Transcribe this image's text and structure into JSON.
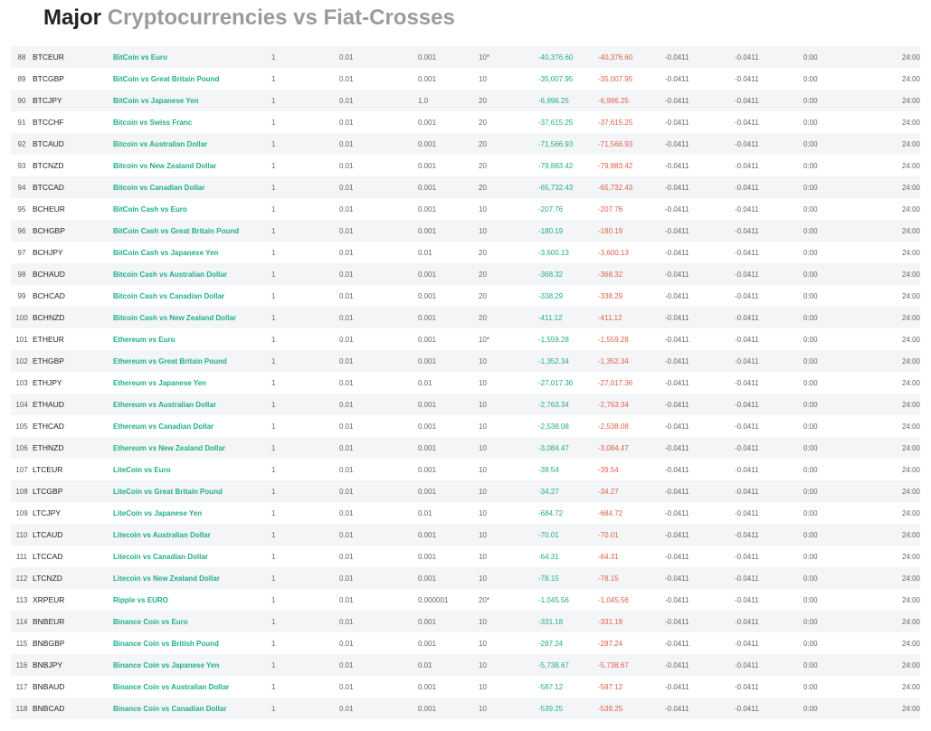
{
  "page": {
    "title_bold": "Major",
    "title_light": "Cryptocurrencies vs Fiat-Crosses"
  },
  "rows": [
    {
      "num": "88",
      "symbol": "BTCEUR",
      "desc": "BitCoin vs Euro",
      "contract": "1",
      "min": "0.01",
      "tick": "0.001",
      "leverage": "10*",
      "long": "-40,376.60",
      "short": "-40,376.60",
      "c1": "-0.0411",
      "c2": "-0.0411",
      "open": "0:00",
      "close": "24:00"
    },
    {
      "num": "89",
      "symbol": "BTCGBP",
      "desc": "BitCoin vs Great Britain Pound",
      "contract": "1",
      "min": "0.01",
      "tick": "0.001",
      "leverage": "10",
      "long": "-35,007.95",
      "short": "-35,007.95",
      "c1": "-0.0411",
      "c2": "-0.0411",
      "open": "0:00",
      "close": "24:00"
    },
    {
      "num": "90",
      "symbol": "BTCJPY",
      "desc": "BitCoin vs Japanese Yen",
      "contract": "1",
      "min": "0.01",
      "tick": "1.0",
      "leverage": "20",
      "long": "-6,996.25",
      "short": "-6,996.25",
      "c1": "-0.0411",
      "c2": "-0.0411",
      "open": "0:00",
      "close": "24:00"
    },
    {
      "num": "91",
      "symbol": "BTCCHF",
      "desc": "Bitcoin vs Swiss Franc",
      "contract": "1",
      "min": "0.01",
      "tick": "0.001",
      "leverage": "20",
      "long": "-37,615.25",
      "short": "-37,615.25",
      "c1": "-0.0411",
      "c2": "-0.0411",
      "open": "0:00",
      "close": "24:00"
    },
    {
      "num": "92",
      "symbol": "BTCAUD",
      "desc": "Bitcoin vs Australian Dollar",
      "contract": "1",
      "min": "0.01",
      "tick": "0.001",
      "leverage": "20",
      "long": "-71,566.93",
      "short": "-71,566.93",
      "c1": "-0.0411",
      "c2": "-0.0411",
      "open": "0:00",
      "close": "24:00"
    },
    {
      "num": "93",
      "symbol": "BTCNZD",
      "desc": "Bitcoin vs New Zealand Dollar",
      "contract": "1",
      "min": "0.01",
      "tick": "0.001",
      "leverage": "20",
      "long": "-79,883.42",
      "short": "-79,883.42",
      "c1": "-0.0411",
      "c2": "-0.0411",
      "open": "0:00",
      "close": "24:00"
    },
    {
      "num": "94",
      "symbol": "BTCCAD",
      "desc": "Bitcoin vs Canadian Dollar",
      "contract": "1",
      "min": "0.01",
      "tick": "0.001",
      "leverage": "20",
      "long": "-65,732.43",
      "short": "-65,732.43",
      "c1": "-0.0411",
      "c2": "-0.0411",
      "open": "0:00",
      "close": "24:00"
    },
    {
      "num": "95",
      "symbol": "BCHEUR",
      "desc": "BitCoin Cash vs Euro",
      "contract": "1",
      "min": "0.01",
      "tick": "0.001",
      "leverage": "10",
      "long": "-207.76",
      "short": "-207.76",
      "c1": "-0.0411",
      "c2": "-0.0411",
      "open": "0:00",
      "close": "24:00"
    },
    {
      "num": "96",
      "symbol": "BCHGBP",
      "desc": "BitCoin Cash vs Great Britain Pound",
      "contract": "1",
      "min": "0.01",
      "tick": "0.001",
      "leverage": "10",
      "long": "-180.19",
      "short": "-180.19",
      "c1": "-0.0411",
      "c2": "-0.0411",
      "open": "0:00",
      "close": "24:00"
    },
    {
      "num": "97",
      "symbol": "BCHJPY",
      "desc": "BitCoin Cash vs Japanese Yen",
      "contract": "1",
      "min": "0.01",
      "tick": "0.01",
      "leverage": "20",
      "long": "-3,600.13",
      "short": "-3,600.13",
      "c1": "-0.0411",
      "c2": "-0.0411",
      "open": "0:00",
      "close": "24:00"
    },
    {
      "num": "98",
      "symbol": "BCHAUD",
      "desc": "Bitcoin Cash vs Australian Dollar",
      "contract": "1",
      "min": "0.01",
      "tick": "0.001",
      "leverage": "20",
      "long": "-368.32",
      "short": "-368.32",
      "c1": "-0.0411",
      "c2": "-0.0411",
      "open": "0:00",
      "close": "24:00"
    },
    {
      "num": "99",
      "symbol": "BCHCAD",
      "desc": "Bitcoin Cash vs Canadian Dollar",
      "contract": "1",
      "min": "0.01",
      "tick": "0.001",
      "leverage": "20",
      "long": "-338.29",
      "short": "-338.29",
      "c1": "-0.0411",
      "c2": "-0.0411",
      "open": "0:00",
      "close": "24:00"
    },
    {
      "num": "100",
      "symbol": "BCHNZD",
      "desc": "Bitcoin Cash vs New Zealand Dollar",
      "contract": "1",
      "min": "0.01",
      "tick": "0.001",
      "leverage": "20",
      "long": "-411.12",
      "short": "-411.12",
      "c1": "-0.0411",
      "c2": "-0.0411",
      "open": "0:00",
      "close": "24:00"
    },
    {
      "num": "101",
      "symbol": "ETHEUR",
      "desc": "Ethereum vs Euro",
      "contract": "1",
      "min": "0.01",
      "tick": "0.001",
      "leverage": "10*",
      "long": "-1,559.28",
      "short": "-1,559.28",
      "c1": "-0.0411",
      "c2": "-0.0411",
      "open": "0:00",
      "close": "24:00"
    },
    {
      "num": "102",
      "symbol": "ETHGBP",
      "desc": "Ethereum vs Great Britain Pound",
      "contract": "1",
      "min": "0.01",
      "tick": "0.001",
      "leverage": "10",
      "long": "-1,352.34",
      "short": "-1,352.34",
      "c1": "-0.0411",
      "c2": "-0.0411",
      "open": "0:00",
      "close": "24:00"
    },
    {
      "num": "103",
      "symbol": "ETHJPY",
      "desc": "Ethereum vs Japanese Yen",
      "contract": "1",
      "min": "0.01",
      "tick": "0.01",
      "leverage": "10",
      "long": "-27,017.36",
      "short": "-27,017.36",
      "c1": "-0.0411",
      "c2": "-0.0411",
      "open": "0:00",
      "close": "24:00"
    },
    {
      "num": "104",
      "symbol": "ETHAUD",
      "desc": "Ethereum vs Australian Dollar",
      "contract": "1",
      "min": "0.01",
      "tick": "0.001",
      "leverage": "10",
      "long": "-2,763.34",
      "short": "-2,763.34",
      "c1": "-0.0411",
      "c2": "-0.0411",
      "open": "0:00",
      "close": "24:00"
    },
    {
      "num": "105",
      "symbol": "ETHCAD",
      "desc": "Ethereum vs Canadian Dollar",
      "contract": "1",
      "min": "0.01",
      "tick": "0.001",
      "leverage": "10",
      "long": "-2,538.08",
      "short": "-2,538.08",
      "c1": "-0.0411",
      "c2": "-0.0411",
      "open": "0:00",
      "close": "24:00"
    },
    {
      "num": "106",
      "symbol": "ETHNZD",
      "desc": "Ethereum vs New Zealand Dollar",
      "contract": "1",
      "min": "0.01",
      "tick": "0.001",
      "leverage": "10",
      "long": "-3,084.47",
      "short": "-3,084.47",
      "c1": "-0.0411",
      "c2": "-0.0411",
      "open": "0:00",
      "close": "24:00"
    },
    {
      "num": "107",
      "symbol": "LTCEUR",
      "desc": "LiteCoin vs Euro",
      "contract": "1",
      "min": "0.01",
      "tick": "0.001",
      "leverage": "10",
      "long": "-39.54",
      "short": "-39.54",
      "c1": "-0.0411",
      "c2": "-0.0411",
      "open": "0:00",
      "close": "24:00"
    },
    {
      "num": "108",
      "symbol": "LTCGBP",
      "desc": "LiteCoin vs Great Britain Pound",
      "contract": "1",
      "min": "0.01",
      "tick": "0.001",
      "leverage": "10",
      "long": "-34.27",
      "short": "-34.27",
      "c1": "-0.0411",
      "c2": "-0.0411",
      "open": "0:00",
      "close": "24:00"
    },
    {
      "num": "109",
      "symbol": "LTCJPY",
      "desc": "LiteCoin vs Japanese Yen",
      "contract": "1",
      "min": "0.01",
      "tick": "0.01",
      "leverage": "10",
      "long": "-684.72",
      "short": "-684.72",
      "c1": "-0.0411",
      "c2": "-0.0411",
      "open": "0:00",
      "close": "24:00"
    },
    {
      "num": "110",
      "symbol": "LTCAUD",
      "desc": "Litecoin vs Australian Dollar",
      "contract": "1",
      "min": "0.01",
      "tick": "0.001",
      "leverage": "10",
      "long": "-70.01",
      "short": "-70.01",
      "c1": "-0.0411",
      "c2": "-0.0411",
      "open": "0:00",
      "close": "24:00"
    },
    {
      "num": "111",
      "symbol": "LTCCAD",
      "desc": "Litecoin vs Canadian Dollar",
      "contract": "1",
      "min": "0.01",
      "tick": "0.001",
      "leverage": "10",
      "long": "-64.31",
      "short": "-64.31",
      "c1": "-0.0411",
      "c2": "-0.0411",
      "open": "0:00",
      "close": "24:00"
    },
    {
      "num": "112",
      "symbol": "LTCNZD",
      "desc": "Litecoin vs New Zealand Dollar",
      "contract": "1",
      "min": "0.01",
      "tick": "0.001",
      "leverage": "10",
      "long": "-78.15",
      "short": "-78.15",
      "c1": "-0.0411",
      "c2": "-0.0411",
      "open": "0:00",
      "close": "24:00"
    },
    {
      "num": "113",
      "symbol": "XRPEUR",
      "desc": "Ripple vs EURO",
      "contract": "1",
      "min": "0.01",
      "tick": "0.000001",
      "leverage": "20*",
      "long": "-1,045.56",
      "short": "-1,045.56",
      "c1": "-0.0411",
      "c2": "-0.0411",
      "open": "0:00",
      "close": "24:00"
    },
    {
      "num": "114",
      "symbol": "BNBEUR",
      "desc": "Binance Coin vs Euro",
      "contract": "1",
      "min": "0.01",
      "tick": "0.001",
      "leverage": "10",
      "long": "-331.18",
      "short": "-331.18",
      "c1": "-0.0411",
      "c2": "-0.0411",
      "open": "0:00",
      "close": "24:00"
    },
    {
      "num": "115",
      "symbol": "BNBGBP",
      "desc": "Binance Coin vs British Pound",
      "contract": "1",
      "min": "0.01",
      "tick": "0.001",
      "leverage": "10",
      "long": "-287.24",
      "short": "-287.24",
      "c1": "-0.0411",
      "c2": "-0.0411",
      "open": "0:00",
      "close": "24:00"
    },
    {
      "num": "116",
      "symbol": "BNBJPY",
      "desc": "Binance Coin vs Japanese Yen",
      "contract": "1",
      "min": "0.01",
      "tick": "0.01",
      "leverage": "10",
      "long": "-5,738.67",
      "short": "-5,738.67",
      "c1": "-0.0411",
      "c2": "-0.0411",
      "open": "0:00",
      "close": "24:00"
    },
    {
      "num": "117",
      "symbol": "BNBAUD",
      "desc": "Binance Coin vs Australian Dollar",
      "contract": "1",
      "min": "0.01",
      "tick": "0.001",
      "leverage": "10",
      "long": "-587.12",
      "short": "-587.12",
      "c1": "-0.0411",
      "c2": "-0.0411",
      "open": "0:00",
      "close": "24:00"
    },
    {
      "num": "118",
      "symbol": "BNBCAD",
      "desc": "Binance Coin vs Canadian Dollar",
      "contract": "1",
      "min": "0.01",
      "tick": "0.001",
      "leverage": "10",
      "long": "-539.25",
      "short": "-539.25",
      "c1": "-0.0411",
      "c2": "-0.0411",
      "open": "0:00",
      "close": "24:00"
    }
  ]
}
